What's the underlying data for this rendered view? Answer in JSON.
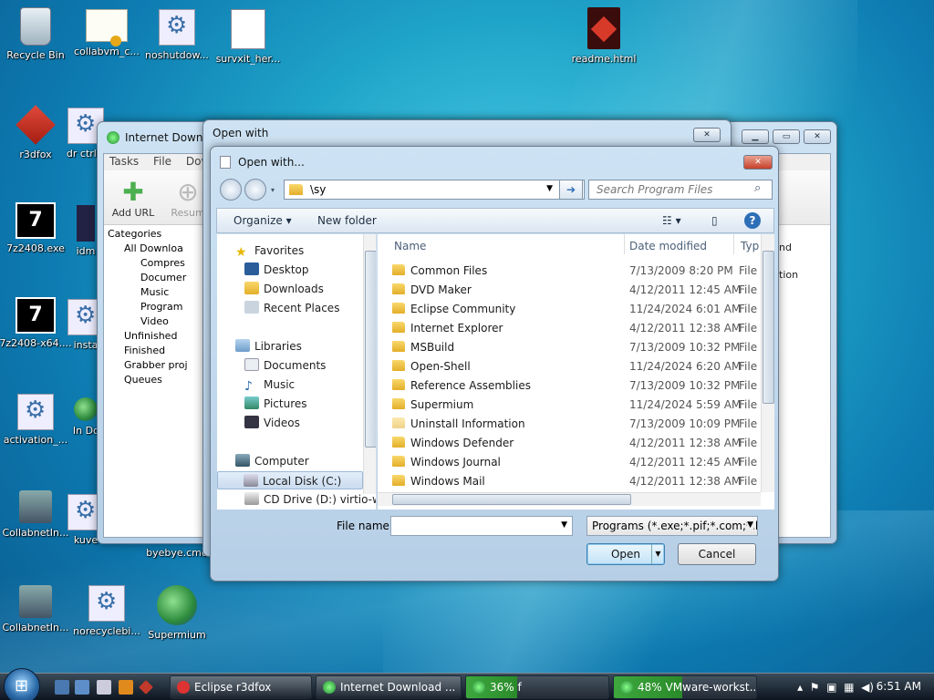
{
  "desktop": {
    "icons": [
      {
        "label": "Recycle Bin"
      },
      {
        "label": "collabvm_c..."
      },
      {
        "label": "noshutdow..."
      },
      {
        "label": "survxit_her..."
      },
      {
        "label": "readme.html"
      },
      {
        "label": "r3dfox"
      },
      {
        "label": "dr ctrl+"
      },
      {
        "label": "7z2408.exe"
      },
      {
        "label": "idm"
      },
      {
        "label": "7z2408-x64...."
      },
      {
        "label": "insta"
      },
      {
        "label": "activation_..."
      },
      {
        "label": "In Dc"
      },
      {
        "label": "CollabnetIn..."
      },
      {
        "label": "kuve"
      },
      {
        "label": "byebye.cmd"
      },
      {
        "label": "CollabnetIn..."
      },
      {
        "label": "norecyclebi..."
      },
      {
        "label": "Supermium"
      }
    ]
  },
  "idm_window": {
    "title": "Internet Downloa",
    "menu": [
      "Tasks",
      "File",
      "Down"
    ],
    "toolbar": {
      "add_url": "Add URL",
      "resume": "Resum"
    },
    "side_labels": {
      "nd": "nd",
      "tion": "tion"
    },
    "categories_header": "Categories",
    "categories": [
      {
        "label": "All Downloa"
      },
      {
        "label": "Compres"
      },
      {
        "label": "Documer"
      },
      {
        "label": "Music"
      },
      {
        "label": "Program"
      },
      {
        "label": "Video"
      },
      {
        "label": "Unfinished"
      },
      {
        "label": "Finished"
      },
      {
        "label": "Grabber proj"
      },
      {
        "label": "Queues"
      }
    ]
  },
  "open_with_outer": {
    "title": "Open with"
  },
  "dialog": {
    "title": "Open with...",
    "address_text": "\\sy",
    "search_placeholder": "Search Program Files",
    "cmd": {
      "organize": "Organize",
      "new_folder": "New folder"
    },
    "nav": {
      "favorites": "Favorites",
      "desktop": "Desktop",
      "downloads": "Downloads",
      "recent": "Recent Places",
      "libraries": "Libraries",
      "documents": "Documents",
      "music": "Music",
      "pictures": "Pictures",
      "videos": "Videos",
      "computer": "Computer",
      "local_disk": "Local Disk (C:)",
      "cd_drive": "CD Drive (D:) virtio-w"
    },
    "columns": {
      "name": "Name",
      "date": "Date modified",
      "type": "Typ"
    },
    "files": [
      {
        "name": "Common Files",
        "date": "7/13/2009 8:20 PM",
        "type": "File"
      },
      {
        "name": "DVD Maker",
        "date": "4/12/2011 12:45 AM",
        "type": "File"
      },
      {
        "name": "Eclipse Community",
        "date": "11/24/2024 6:01 AM",
        "type": "File"
      },
      {
        "name": "Internet Explorer",
        "date": "4/12/2011 12:38 AM",
        "type": "File"
      },
      {
        "name": "MSBuild",
        "date": "7/13/2009 10:32 PM",
        "type": "File"
      },
      {
        "name": "Open-Shell",
        "date": "11/24/2024 6:20 AM",
        "type": "File"
      },
      {
        "name": "Reference Assemblies",
        "date": "7/13/2009 10:32 PM",
        "type": "File"
      },
      {
        "name": "Supermium",
        "date": "11/24/2024 5:59 AM",
        "type": "File"
      },
      {
        "name": "Uninstall Information",
        "date": "7/13/2009 10:09 PM",
        "type": "File"
      },
      {
        "name": "Windows Defender",
        "date": "4/12/2011 12:38 AM",
        "type": "File"
      },
      {
        "name": "Windows Journal",
        "date": "4/12/2011 12:45 AM",
        "type": "File"
      },
      {
        "name": "Windows Mail",
        "date": "4/12/2011 12:38 AM",
        "type": "File"
      }
    ],
    "file_name_label": "File name:",
    "file_name_value": "",
    "file_type": "Programs (*.exe;*.pif;*.com;*.ba",
    "open_label": "Open",
    "cancel_label": "Cancel"
  },
  "taskbar": {
    "buttons": [
      {
        "label": "Eclipse r3dfox"
      },
      {
        "label": "Internet Download ..."
      },
      {
        "label": "36% f"
      },
      {
        "label": "48% VMware-workst..."
      }
    ],
    "clock": "6:51 AM"
  }
}
